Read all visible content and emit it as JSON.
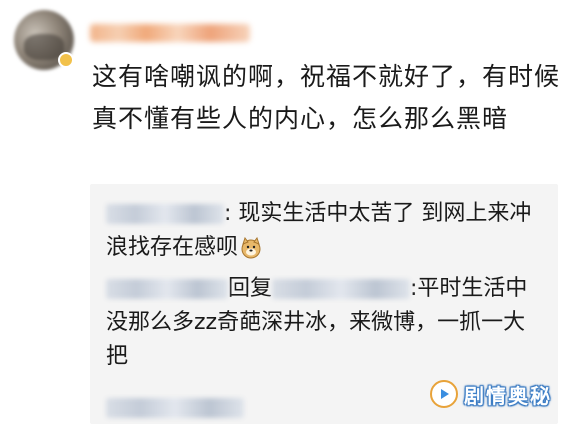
{
  "comment": {
    "text": "这有啥嘲讽的啊，祝福不就好了，有时候真不懂有些人的内心，怎么那么黑暗"
  },
  "replies": [
    {
      "text": ": 现实生活中太苦了 到网上来冲浪找存在感呗",
      "emoji": "doge-icon"
    },
    {
      "reply_word": "回复",
      "text": ":平时生活中没那么多zz奇葩深井冰，来微博，一抓一大把"
    }
  ],
  "watermark": {
    "text": "剧情奥秘"
  },
  "colors": {
    "reply_bg": "#f4f4f4",
    "watermark_outline": "#2f6fb8",
    "watermark_logo": "#e8a33a"
  }
}
